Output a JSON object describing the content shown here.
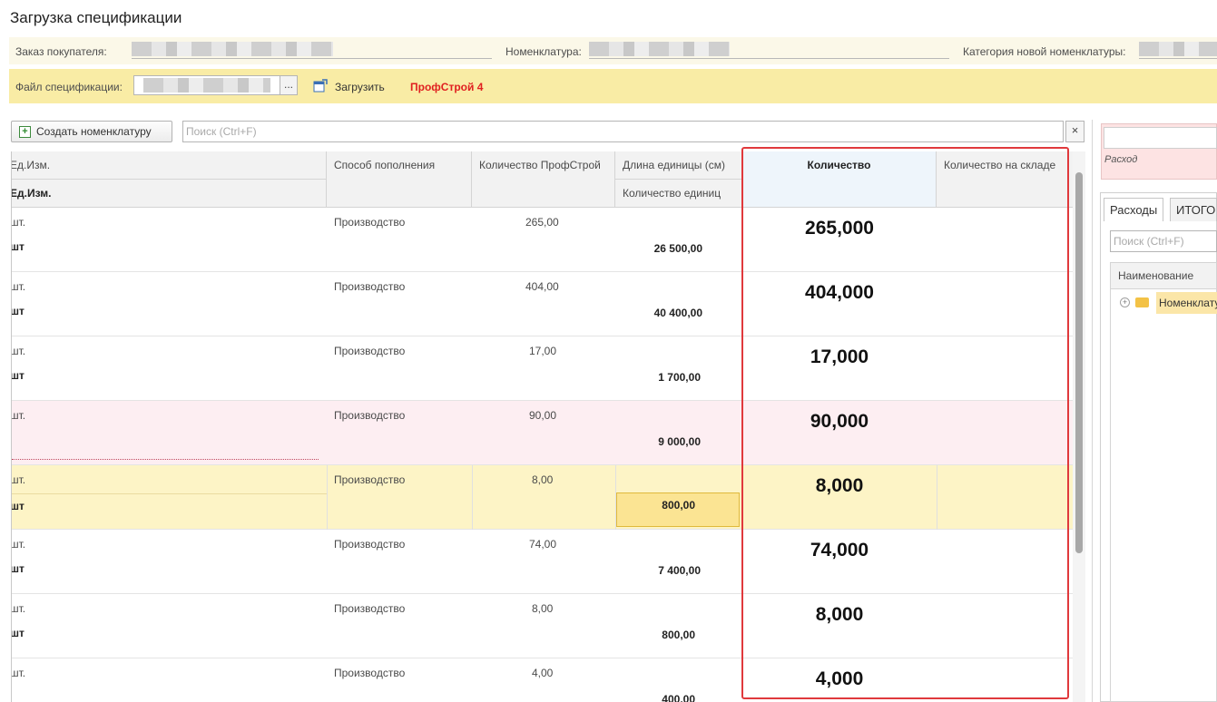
{
  "window": {
    "title": "Загрузка спецификации"
  },
  "header": {
    "order_label": "Заказ покупателя:",
    "nomenclature_label": "Номенклатура:",
    "category_label": "Категория новой номенклатуры:",
    "file_label": "Файл спецификации:",
    "file_button": "...",
    "load_label": "Загрузить",
    "profile_label": "ПрофСтрой 4"
  },
  "toolbar": {
    "create_label": "Создать номенклатуру",
    "search_placeholder": "Поиск (Ctrl+F)",
    "clear_label": "×"
  },
  "table": {
    "columns": {
      "unit": "Ед.Изм.",
      "unit2": "Ед.Изм.",
      "method": "Способ пополнения",
      "qty_profstroy": "Количество ПрофСтрой",
      "unit_length": "Длина единицы (см)",
      "unit_count": "Количество единиц",
      "quantity": "Количество",
      "stock": "Количество на складе"
    },
    "rows": [
      {
        "unit": "шт.",
        "unit2": "шт",
        "method": "Производство",
        "qty_ps": "265,00",
        "units": "26 500,00",
        "qty": "265,000"
      },
      {
        "unit": "шт.",
        "unit2": "шт",
        "method": "Производство",
        "qty_ps": "404,00",
        "units": "40 400,00",
        "qty": "404,000"
      },
      {
        "unit": "шт.",
        "unit2": "шт",
        "method": "Производство",
        "qty_ps": "17,00",
        "units": "1 700,00",
        "qty": "17,000"
      },
      {
        "unit": "шт.",
        "unit2": "",
        "method": "Производство",
        "qty_ps": "90,00",
        "units": "9 000,00",
        "qty": "90,000"
      },
      {
        "unit": "шт.",
        "unit2": "шт",
        "method": "Производство",
        "qty_ps": "8,00",
        "units": "800,00",
        "qty": "8,000"
      },
      {
        "unit": "шт.",
        "unit2": "шт",
        "method": "Производство",
        "qty_ps": "74,00",
        "units": "7 400,00",
        "qty": "74,000"
      },
      {
        "unit": "шт.",
        "unit2": "шт",
        "method": "Производство",
        "qty_ps": "8,00",
        "units": "800,00",
        "qty": "8,000"
      },
      {
        "unit": "шт.",
        "unit2": "",
        "method": "Производство",
        "qty_ps": "4,00",
        "units": "400,00",
        "qty": "4,000"
      }
    ]
  },
  "right_panel": {
    "expense_label": "Расход",
    "tabs": [
      "Расходы",
      "ИТОГО"
    ],
    "search_placeholder": "Поиск (Ctrl+F)",
    "column_name": "Наименование",
    "tree_item": "Номенклатура"
  },
  "colors": {
    "highlight_yellow": "#f9eca5",
    "row_pink": "#fdeef2",
    "row_selected": "#fdf4c6",
    "red_frame": "#e0393c",
    "profile_red": "#e02020"
  },
  "icons": {
    "load": "load-file-icon",
    "create": "plus-icon",
    "folder": "folder-icon"
  }
}
